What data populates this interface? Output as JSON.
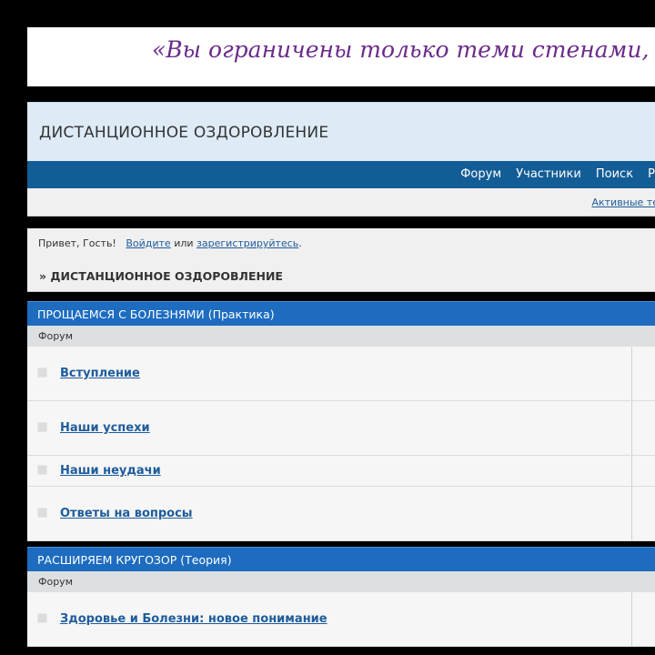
{
  "banner": {
    "quote": "«Вы ограничены только теми стенами, ко"
  },
  "header": {
    "site_title": "ДИСТАНЦИОННОЕ ОЗДОРОВЛЕНИЕ"
  },
  "nav": {
    "items": [
      "Форум",
      "Участники",
      "Поиск",
      "Р"
    ]
  },
  "subnav": {
    "active_topics": "Активные те"
  },
  "welcome": {
    "greeting": "Привет, Гость!",
    "login": "Войдите",
    "or": "или",
    "register": "зарегистрируйтесь",
    "dot": "."
  },
  "breadcrumb": {
    "text": "» ДИСТАНЦИОННОЕ ОЗДОРОВЛЕНИЕ"
  },
  "categories": [
    {
      "title": "ПРОЩАЕМСЯ С БОЛЕЗНЯМИ (Практика)",
      "column": "Форум",
      "forums": [
        "Вступление",
        "Наши успехи",
        "Наши неудачи",
        "Ответы на вопросы"
      ]
    },
    {
      "title": "РАСШИРЯЕМ КРУГОЗОР (Теория)",
      "column": "Форум",
      "forums": [
        "Здоровье и Болезни: новое понимание"
      ]
    }
  ]
}
